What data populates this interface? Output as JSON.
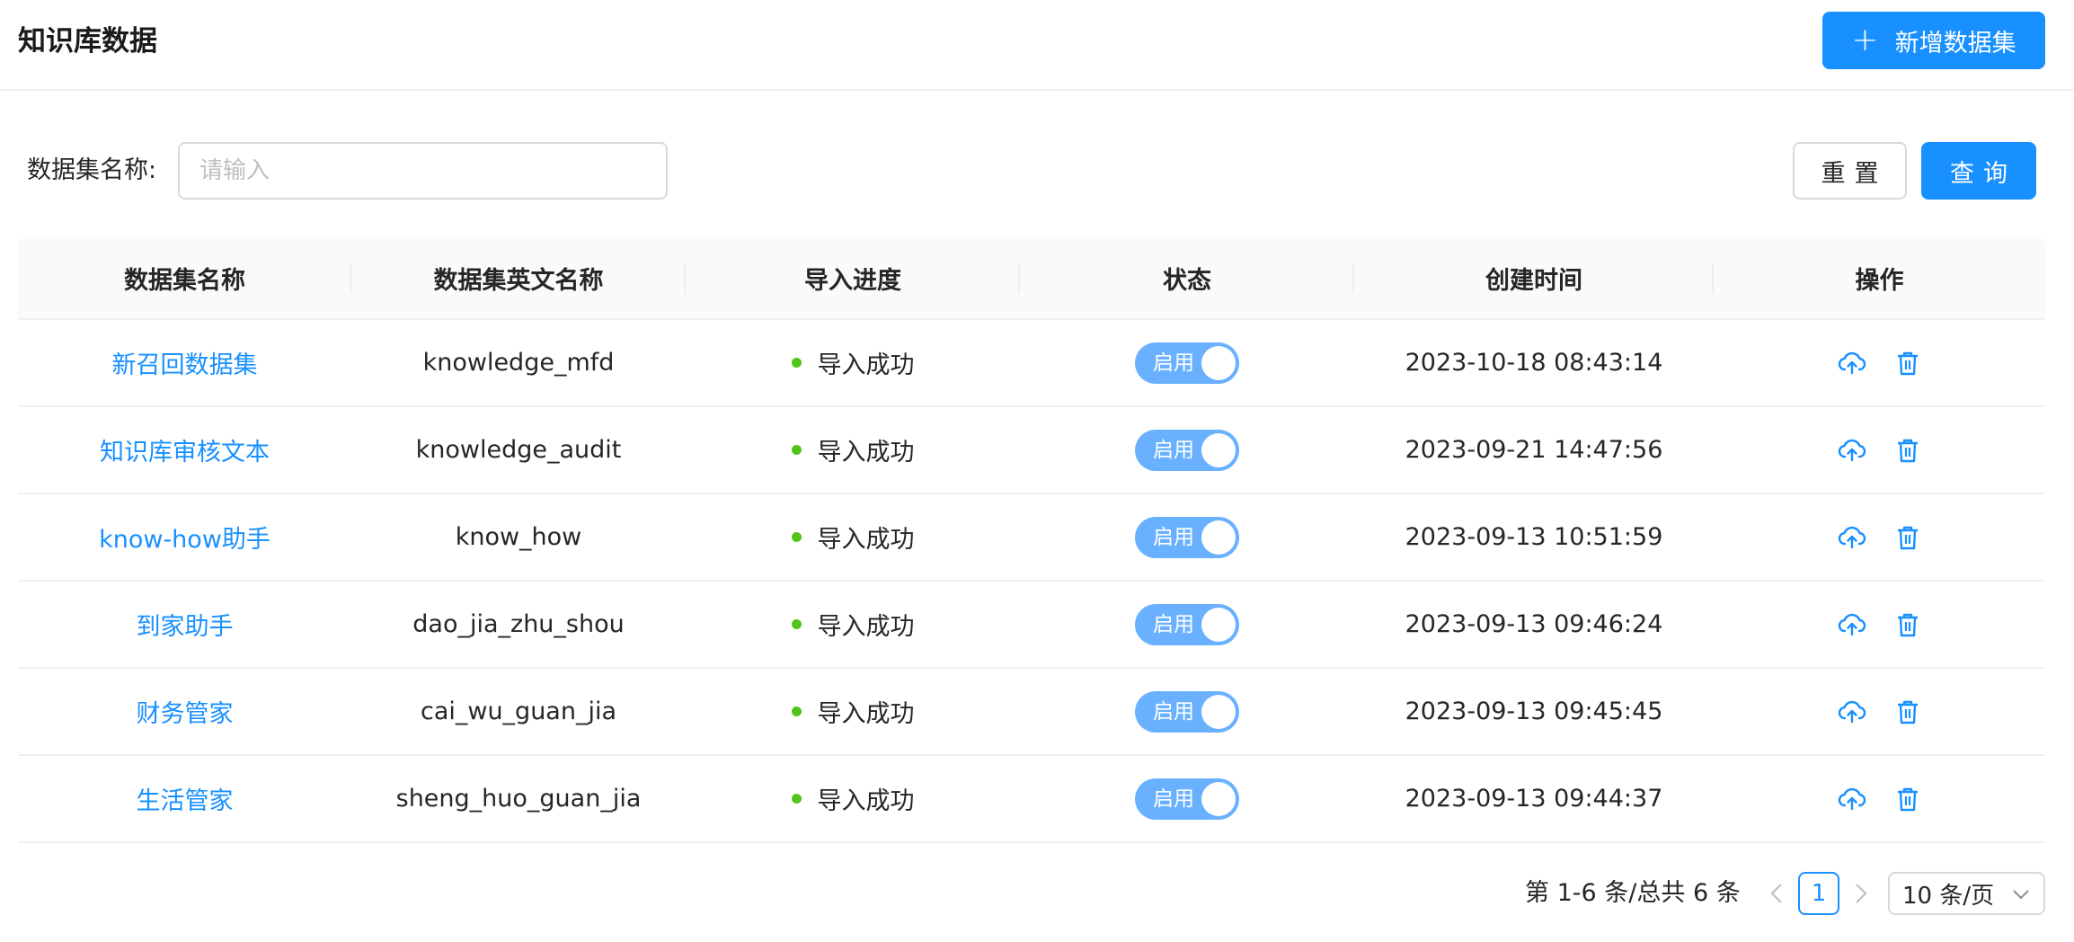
{
  "header": {
    "title": "知识库数据",
    "add_button": "新增数据集"
  },
  "search": {
    "label": "数据集名称:",
    "placeholder": "请输入",
    "value": "",
    "reset_label": "重置",
    "query_label": "查询"
  },
  "table": {
    "columns": [
      "数据集名称",
      "数据集英文名称",
      "导入进度",
      "状态",
      "创建时间",
      "操作"
    ],
    "rows": [
      {
        "name": "新召回数据集",
        "english_name": "knowledge_mfd",
        "progress": "导入成功",
        "status": "启用",
        "created": "2023-10-18 08:43:14"
      },
      {
        "name": "知识库审核文本",
        "english_name": "knowledge_audit",
        "progress": "导入成功",
        "status": "启用",
        "created": "2023-09-21 14:47:56"
      },
      {
        "name": "know-how助手",
        "english_name": "know_how",
        "progress": "导入成功",
        "status": "启用",
        "created": "2023-09-13 10:51:59"
      },
      {
        "name": "到家助手",
        "english_name": "dao_jia_zhu_shou",
        "progress": "导入成功",
        "status": "启用",
        "created": "2023-09-13 09:46:24"
      },
      {
        "name": "财务管家",
        "english_name": "cai_wu_guan_jia",
        "progress": "导入成功",
        "status": "启用",
        "created": "2023-09-13 09:45:45"
      },
      {
        "name": "生活管家",
        "english_name": "sheng_huo_guan_jia",
        "progress": "导入成功",
        "status": "启用",
        "created": "2023-09-13 09:44:37"
      }
    ],
    "action_icons": [
      "upload-cloud-icon",
      "trash-icon"
    ]
  },
  "pagination": {
    "total_text": "第 1-6 条/总共 6 条",
    "current_page": "1",
    "page_size": "10 条/页"
  },
  "colors": {
    "primary": "#1890ff",
    "toggle_on": "#69b1ff",
    "success_dot": "#52c41a"
  }
}
